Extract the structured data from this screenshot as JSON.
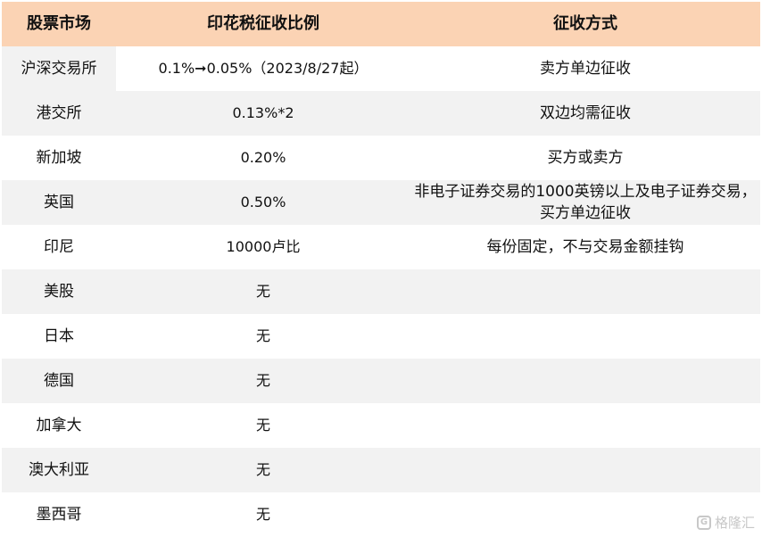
{
  "table": {
    "headers": [
      "股票市场",
      "印花税征收比例",
      "征收方式"
    ],
    "rows": [
      {
        "market": "沪深交易所",
        "rate": "0.1%➞0.05%（2023/8/27起）",
        "method": "卖方单边征收"
      },
      {
        "market": "港交所",
        "rate": "0.13%*2",
        "method": "双边均需征收"
      },
      {
        "market": "新加坡",
        "rate": "0.20%",
        "method": "买方或卖方"
      },
      {
        "market": "英国",
        "rate": "0.50%",
        "method": "非电子证券交易的1000英镑以上及电子证券交易，买方单边征收"
      },
      {
        "market": "印尼",
        "rate": "10000卢比",
        "method": "每份固定，不与交易金额挂钩"
      },
      {
        "market": "美股",
        "rate": "无",
        "method": ""
      },
      {
        "market": "日本",
        "rate": "无",
        "method": ""
      },
      {
        "market": "德国",
        "rate": "无",
        "method": ""
      },
      {
        "market": "加拿大",
        "rate": "无",
        "method": ""
      },
      {
        "market": "澳大利亚",
        "rate": "无",
        "method": ""
      },
      {
        "market": "墨西哥",
        "rate": "无",
        "method": ""
      }
    ]
  },
  "watermark": {
    "text": "格隆汇",
    "logo_glyph": "G"
  },
  "colors": {
    "header_bg": "#fbd3b4",
    "band_bg": "#f2f2f2"
  }
}
